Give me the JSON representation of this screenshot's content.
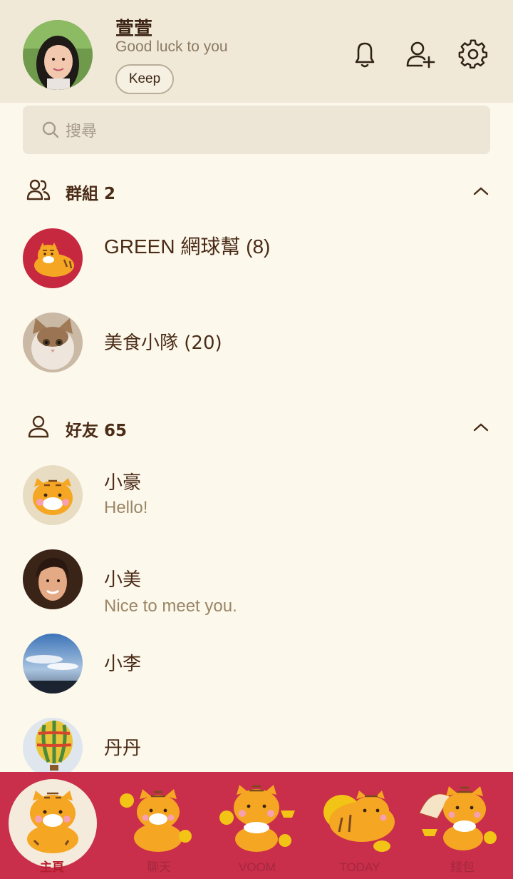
{
  "profile": {
    "name": "萱萱",
    "status": "Good luck to you",
    "keep_label": "Keep"
  },
  "header_icons": [
    "bell-icon",
    "add-friend-icon",
    "settings-icon"
  ],
  "search": {
    "placeholder": "搜尋"
  },
  "groups": {
    "title": "群組 2",
    "items": [
      {
        "name": "GREEN 網球幫 (8)"
      },
      {
        "name": "美食小隊 (20)"
      }
    ]
  },
  "friends": {
    "title": "好友 65",
    "items": [
      {
        "name": "小豪",
        "status": "Hello!"
      },
      {
        "name": "小美",
        "status": "Nice to meet you."
      },
      {
        "name": "小李",
        "status": ""
      },
      {
        "name": "丹丹",
        "status": ""
      }
    ]
  },
  "tabs": [
    {
      "label": "主頁",
      "active": true
    },
    {
      "label": "聊天",
      "active": false
    },
    {
      "label": "VOOM",
      "active": false
    },
    {
      "label": "TODAY",
      "active": false
    },
    {
      "label": "錢包",
      "active": false
    }
  ],
  "colors": {
    "header_bg": "#f1e9d7",
    "page_bg": "#fdf8ec",
    "tab_bar_bg": "#c92e4a",
    "text_primary": "#4a2c17",
    "text_secondary": "#9a8666"
  }
}
